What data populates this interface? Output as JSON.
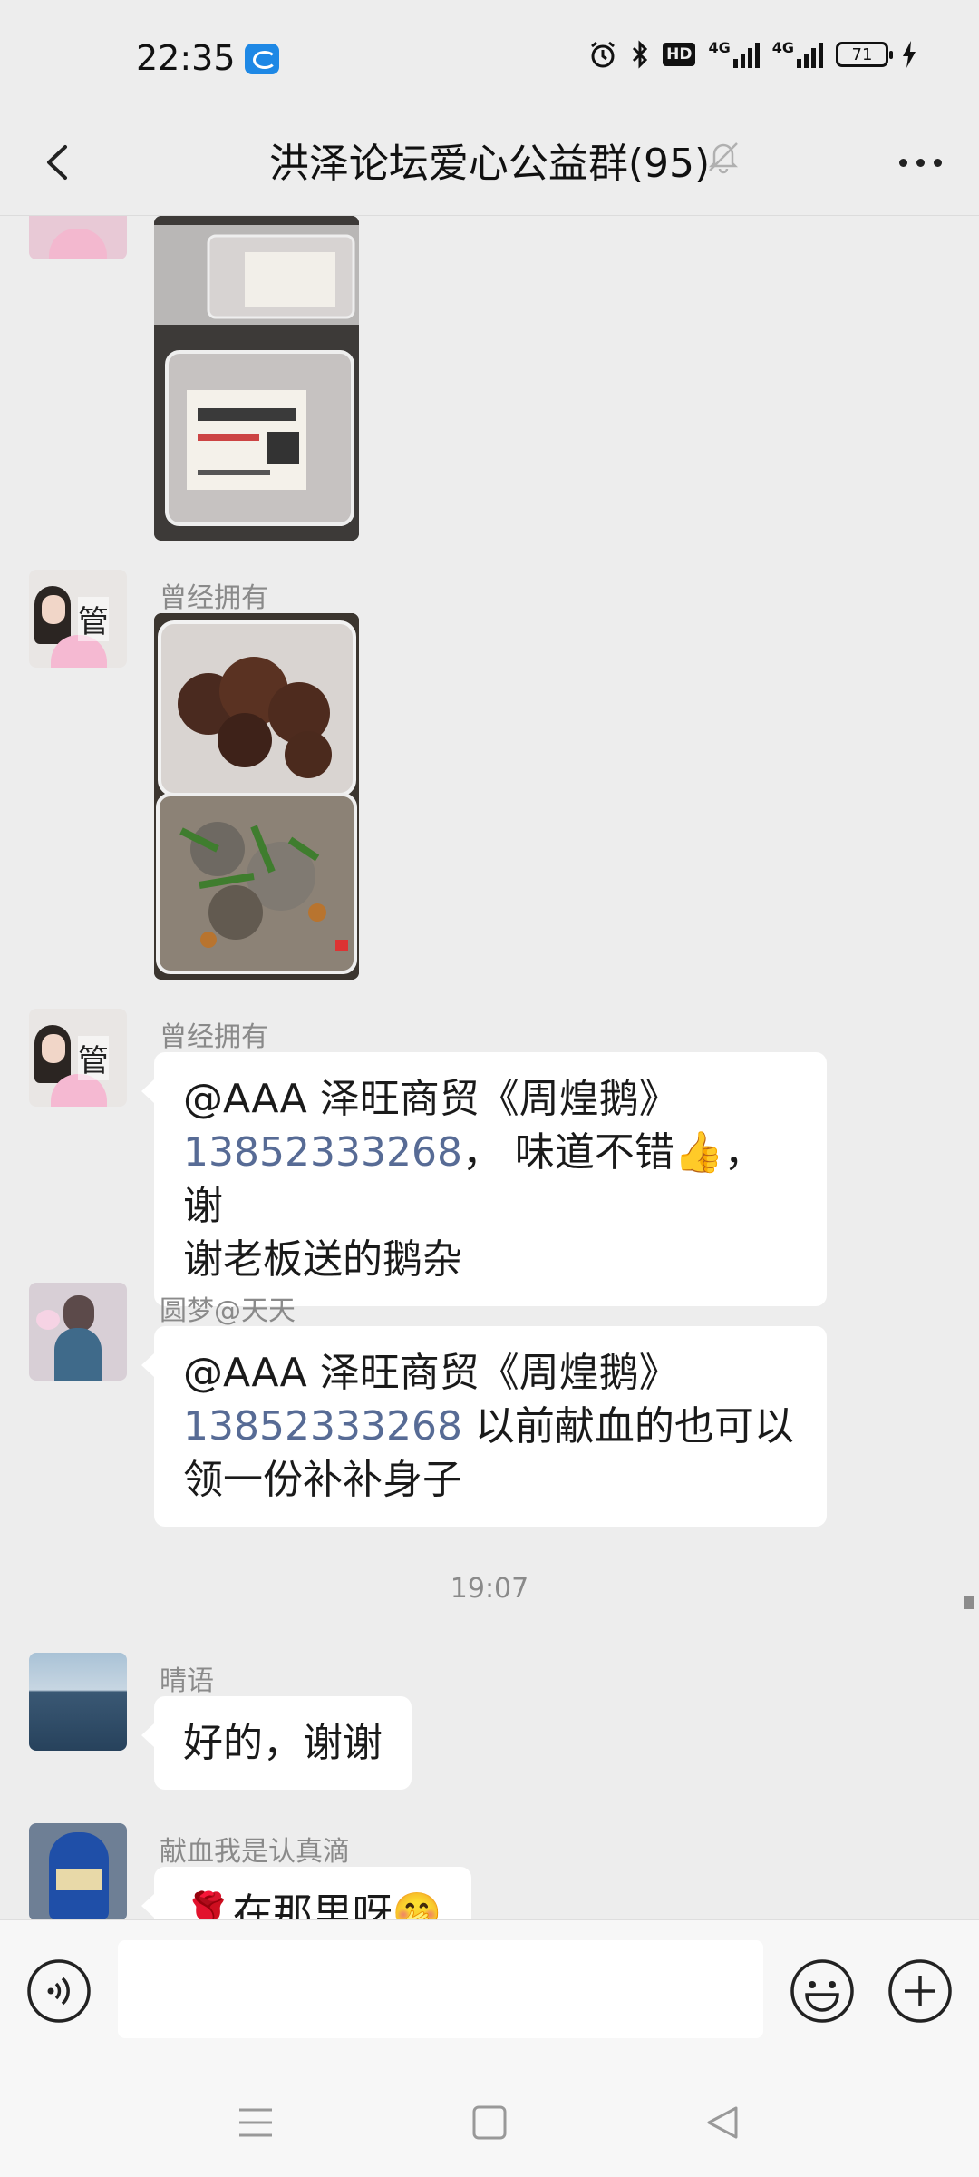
{
  "status_bar": {
    "time": "22:35",
    "signal_label_1": "4G",
    "signal_label_2": "4G",
    "hd_label": "HD",
    "battery": "71",
    "icons": [
      "app-notification-icon",
      "alarm-icon",
      "bluetooth-icon",
      "hd-icon",
      "signal-icon",
      "battery-icon",
      "charging-icon"
    ]
  },
  "header": {
    "title": "洪泽论坛爱心公益群(95)",
    "icons": [
      "back-arrow-icon",
      "mute-bell-icon",
      "more-dots-icon"
    ]
  },
  "messages": [
    {
      "type": "image",
      "sender": "",
      "description_icon": "food-box-photo"
    },
    {
      "type": "image",
      "sender": "曾经拥有",
      "avatar_badge": "管"
    },
    {
      "type": "text",
      "sender": "曾经拥有",
      "avatar_badge": "管",
      "line1": "@AAA 泽旺商贸《周煌鹅》",
      "phone": "13852333268",
      "line2_rest": "， 味道不错👍，谢",
      "line3": "谢老板送的鹅杂"
    },
    {
      "type": "text",
      "sender": "圆梦@天天",
      "line1": "@AAA 泽旺商贸《周煌鹅》",
      "phone": "13852333268",
      "line2_rest": " 以前献血的也可以",
      "line3": "领一份补补身子"
    },
    {
      "type": "timestamp",
      "text": "19:07"
    },
    {
      "type": "text",
      "sender": "晴语",
      "text": "好的，谢谢"
    },
    {
      "type": "text",
      "sender": "献血我是认真滴",
      "text": "🌹在那里呀🤭"
    }
  ],
  "input_bar": {
    "placeholder": "",
    "icons": [
      "voice-icon",
      "emoji-icon",
      "plus-icon"
    ]
  },
  "nav_bar": {
    "icons": [
      "menu-icon",
      "home-icon",
      "back-icon"
    ]
  },
  "colors": {
    "background": "#ededed",
    "bubble": "#ffffff",
    "link": "#576b95",
    "meta_text": "#8a8a8a"
  }
}
